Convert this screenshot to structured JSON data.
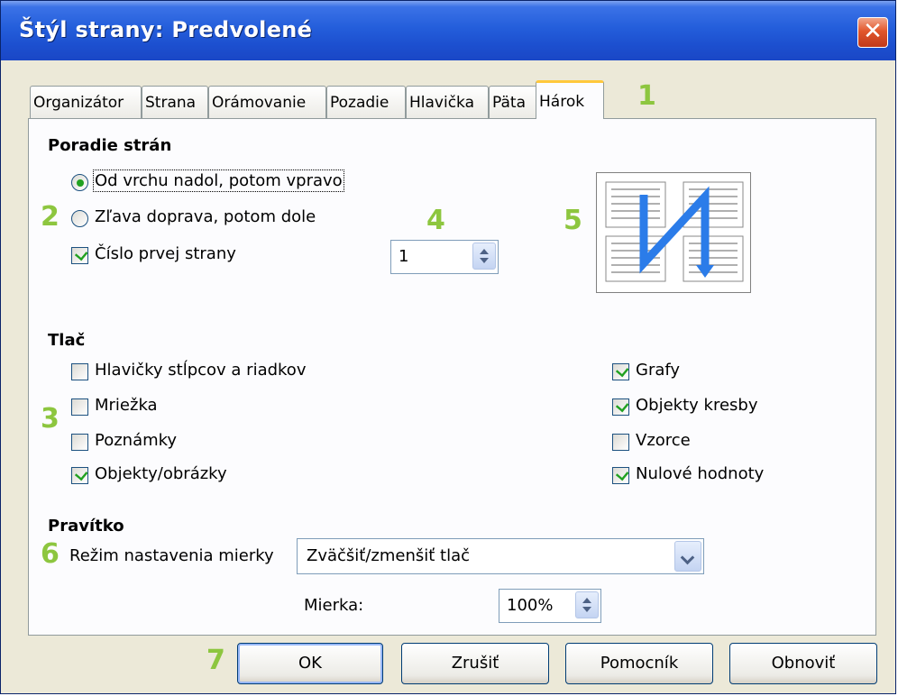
{
  "window": {
    "title": "Štýl strany: Predvolené"
  },
  "tabs": [
    "Organizátor",
    "Strana",
    "Orámovanie",
    "Pozadie",
    "Hlavička",
    "Päta",
    "Hárok"
  ],
  "active_tab": "Hárok",
  "markers": [
    "1",
    "2",
    "3",
    "4",
    "5",
    "6",
    "7"
  ],
  "page_order": {
    "heading": "Poradie strán",
    "option_top_down": "Od vrchu nadol, potom vpravo",
    "option_left_right": "Zľava doprava, potom dole",
    "selected": "Od vrchu nadol, potom vpravo",
    "first_page_number_label": "Číslo prvej strany",
    "first_page_number_checked": true,
    "first_page_number_value": "1"
  },
  "print": {
    "heading": "Tlač",
    "left": [
      {
        "label": "Hlavičky stĺpcov a riadkov",
        "checked": false
      },
      {
        "label": "Mriežka",
        "checked": false
      },
      {
        "label": "Poznámky",
        "checked": false
      },
      {
        "label": "Objekty/obrázky",
        "checked": true
      }
    ],
    "right": [
      {
        "label": "Grafy",
        "checked": true
      },
      {
        "label": "Objekty kresby",
        "checked": true
      },
      {
        "label": "Vzorce",
        "checked": false
      },
      {
        "label": "Nulové hodnoty",
        "checked": true
      }
    ]
  },
  "ruler": {
    "heading": "Pravítko",
    "mode_label": "Režim nastavenia mierky",
    "mode_value": "Zväčšiť/zmenšiť tlač",
    "scale_label": "Mierka:",
    "scale_value": "100%"
  },
  "buttons": {
    "ok": "OK",
    "cancel": "Zrušiť",
    "help": "Pomocník",
    "reset": "Obnoviť"
  },
  "colors": {
    "marker": "#8dc63f",
    "titlebar": "#245edb",
    "check": "#21a121",
    "arrow": "#2b7ce9"
  }
}
